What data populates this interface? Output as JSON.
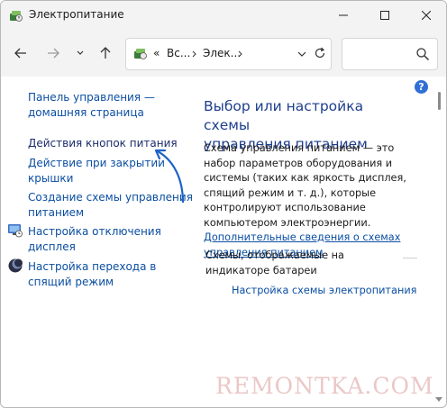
{
  "window": {
    "title": "Электропитание"
  },
  "address": {
    "chevrons": "«",
    "crumb1": "Вс...",
    "crumb2": "Элек..."
  },
  "left_links": [
    {
      "label": "Панель управления —\nдомашняя страница"
    },
    {
      "label": "Действия кнопок питания"
    },
    {
      "label": "Действие при закрытии\nкрышки"
    },
    {
      "label": "Создание схемы управления\nпитанием"
    },
    {
      "label": "Настройка отключения\nдисплея"
    },
    {
      "label": "Настройка перехода в\nспящий режим"
    }
  ],
  "main": {
    "heading": "Выбор или настройка схемы\nуправления питанием",
    "description": "Схема управления питанием — это набор параметров оборудования и системы (таких как яркость дисплея, спящий режим и т. д.), которые контролируют использование компьютером электроэнергии.",
    "more_link": "Дополнительные сведения о схемах управления питанием",
    "schemes_label": "Схемы, отображаемые на индикаторе батареи",
    "scheme_settings_link": "Настройка схемы электропитания"
  },
  "help_label": "?",
  "watermark": "REMONTKA.COM",
  "colors": {
    "accent": "#1e3f8c",
    "link": "#0b4ea2",
    "chrome": "#f3f3f3"
  },
  "icons": {
    "app": "power-options-icon",
    "display": "monitor-clock-icon",
    "sleep": "moon-icon",
    "search": "search-icon"
  }
}
